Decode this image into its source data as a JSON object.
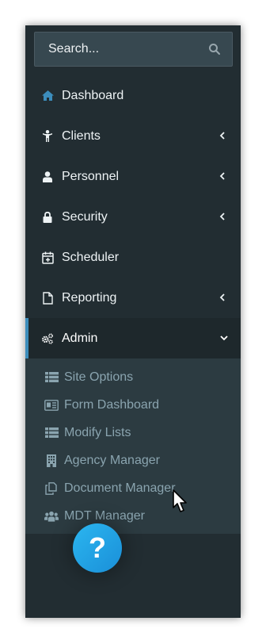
{
  "search": {
    "placeholder": "Search..."
  },
  "menu": {
    "items": [
      {
        "label": "Dashboard",
        "icon": "home-icon",
        "has_submenu": false
      },
      {
        "label": "Clients",
        "icon": "person-icon",
        "has_submenu": true
      },
      {
        "label": "Personnel",
        "icon": "user-icon",
        "has_submenu": true
      },
      {
        "label": "Security",
        "icon": "lock-icon",
        "has_submenu": true
      },
      {
        "label": "Scheduler",
        "icon": "calendar-plus-icon",
        "has_submenu": false
      },
      {
        "label": "Reporting",
        "icon": "file-icon",
        "has_submenu": true
      },
      {
        "label": "Admin",
        "icon": "cogs-icon",
        "has_submenu": true,
        "expanded": true
      }
    ],
    "admin_submenu": [
      {
        "label": "Site Options",
        "icon": "list-icon"
      },
      {
        "label": "Form Dashboard",
        "icon": "id-card-icon"
      },
      {
        "label": "Modify Lists",
        "icon": "list-icon"
      },
      {
        "label": "Agency Manager",
        "icon": "building-icon"
      },
      {
        "label": "Document Manager",
        "icon": "copy-icon"
      },
      {
        "label": "MDT Manager",
        "icon": "users-icon"
      }
    ]
  },
  "help": {
    "label": "?"
  },
  "colors": {
    "sidebar_bg": "#222d32",
    "submenu_bg": "#2c3b41",
    "active_bg": "#1e282c",
    "accent": "#3c8dbc",
    "help_button": "#1fa2e6"
  }
}
